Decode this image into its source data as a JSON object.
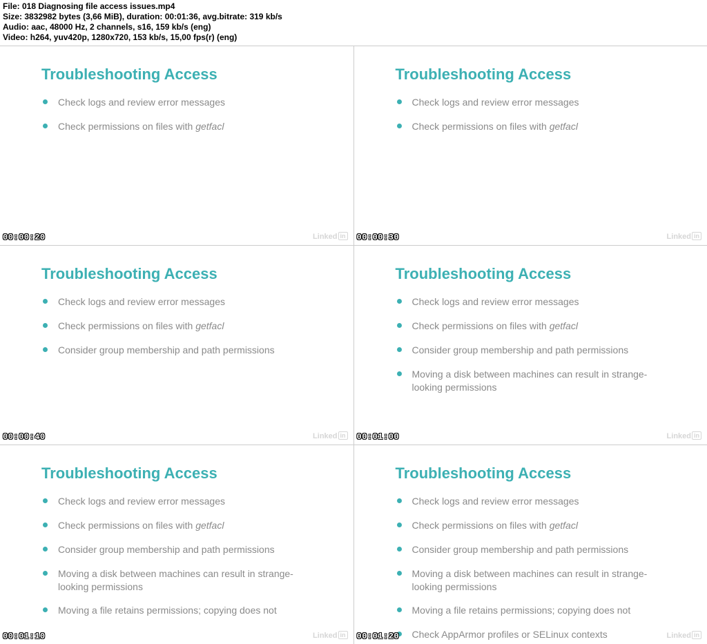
{
  "meta": {
    "file": "File: 018 Diagnosing file access issues.mp4",
    "size": "Size: 3832982 bytes (3,66 MiB), duration: 00:01:36, avg.bitrate: 319 kb/s",
    "audio": "Audio: aac, 48000 Hz, 2 channels, s16, 159 kb/s (eng)",
    "video": "Video: h264, yuv420p, 1280x720, 153 kb/s, 15,00 fps(r) (eng)"
  },
  "title": "Troubleshooting Access",
  "logo": {
    "text": "Linked",
    "box": "in"
  },
  "bullets": {
    "b1": "Check logs and review error messages",
    "b2_prefix": "Check permissions on files with ",
    "b2_em": "getfacl",
    "b3": "Consider group membership and path permissions",
    "b4": "Moving a disk between machines can result in strange-looking permissions",
    "b5": "Moving a file retains permissions; copying does not",
    "b6": "Check AppArmor profiles or SELinux contexts"
  },
  "frames": [
    {
      "timestamp": "00:00:20",
      "show": 2
    },
    {
      "timestamp": "00:00:30",
      "show": 2
    },
    {
      "timestamp": "00:00:40",
      "show": 3
    },
    {
      "timestamp": "00:01:00",
      "show": 4
    },
    {
      "timestamp": "00:01:10",
      "show": 5
    },
    {
      "timestamp": "00:01:20",
      "show": 6
    }
  ]
}
